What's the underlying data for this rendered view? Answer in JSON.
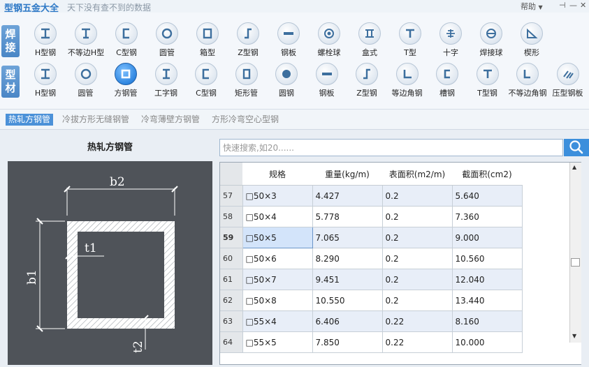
{
  "app": {
    "title": "型钢五金大全",
    "subtitle": "天下没有查不到的数据",
    "help": "帮助",
    "help_arrow": "▼"
  },
  "window_controls": {
    "pin": "⊣",
    "minimize": "—",
    "close": "✕"
  },
  "ribbon": {
    "group1": {
      "label": "焊接",
      "items": [
        {
          "label": "H型钢",
          "icon": "h-beam-icon"
        },
        {
          "label": "不等边H型",
          "icon": "unequal-h-icon"
        },
        {
          "label": "C型钢",
          "icon": "c-channel-icon"
        },
        {
          "label": "圆管",
          "icon": "round-pipe-icon"
        },
        {
          "label": "箱型",
          "icon": "box-section-icon"
        },
        {
          "label": "Z型钢",
          "icon": "z-section-icon"
        },
        {
          "label": "钢板",
          "icon": "steel-plate-icon"
        },
        {
          "label": "螺栓球",
          "icon": "bolt-ball-icon"
        },
        {
          "label": "盒式",
          "icon": "box-type-icon"
        },
        {
          "label": "T型",
          "icon": "t-section-icon"
        },
        {
          "label": "十字",
          "icon": "cross-section-icon"
        },
        {
          "label": "焊接球",
          "icon": "weld-ball-icon"
        },
        {
          "label": "楔形",
          "icon": "wedge-icon"
        }
      ]
    },
    "group2": {
      "label": "型材",
      "items": [
        {
          "label": "H型钢",
          "icon": "h-beam-icon"
        },
        {
          "label": "圆管",
          "icon": "round-pipe-icon"
        },
        {
          "label": "方钢管",
          "icon": "square-tube-icon"
        },
        {
          "label": "工字钢",
          "icon": "i-beam-icon"
        },
        {
          "label": "C型钢",
          "icon": "c-channel-icon"
        },
        {
          "label": "矩形管",
          "icon": "rect-tube-icon"
        },
        {
          "label": "圆钢",
          "icon": "round-bar-icon"
        },
        {
          "label": "钢板",
          "icon": "steel-plate-icon"
        },
        {
          "label": "Z型钢",
          "icon": "z-section-icon"
        },
        {
          "label": "等边角钢",
          "icon": "equal-angle-icon"
        },
        {
          "label": "槽钢",
          "icon": "channel-icon"
        },
        {
          "label": "T型钢",
          "icon": "t-section-icon"
        },
        {
          "label": "不等边角钢",
          "icon": "unequal-angle-icon"
        },
        {
          "label": "压型钢板",
          "icon": "profiled-sheet-icon"
        }
      ],
      "selected_index": 2
    }
  },
  "subtabs": [
    {
      "label": "热轧方钢管",
      "active": true
    },
    {
      "label": "冷拔方形无缝钢管",
      "active": false
    },
    {
      "label": "冷弯薄壁方钢管",
      "active": false
    },
    {
      "label": "方形冷弯空心型钢",
      "active": false
    }
  ],
  "diagram": {
    "title": "热轧方钢管",
    "labels": {
      "b2": "b2",
      "b1": "b1",
      "t1": "t1",
      "t2": "t2"
    }
  },
  "search": {
    "placeholder": "快速搜索,如20......",
    "value": ""
  },
  "table": {
    "headers": [
      "规格",
      "重量(kg/m)",
      "表面积(m2/m)",
      "截面积(cm2)"
    ],
    "rows": [
      {
        "idx": "57",
        "spec": "□50×3",
        "weight": "4.427",
        "surface": "0.2",
        "area": "5.640"
      },
      {
        "idx": "58",
        "spec": "□50×4",
        "weight": "5.778",
        "surface": "0.2",
        "area": "7.360"
      },
      {
        "idx": "59",
        "spec": "□50×5",
        "weight": "7.065",
        "surface": "0.2",
        "area": "9.000"
      },
      {
        "idx": "60",
        "spec": "□50×6",
        "weight": "8.290",
        "surface": "0.2",
        "area": "10.560"
      },
      {
        "idx": "61",
        "spec": "□50×7",
        "weight": "9.451",
        "surface": "0.2",
        "area": "12.040"
      },
      {
        "idx": "62",
        "spec": "□50×8",
        "weight": "10.550",
        "surface": "0.2",
        "area": "13.440"
      },
      {
        "idx": "63",
        "spec": "□55×4",
        "weight": "6.406",
        "surface": "0.22",
        "area": "8.160"
      },
      {
        "idx": "64",
        "spec": "□55×5",
        "weight": "7.850",
        "surface": "0.22",
        "area": "10.000"
      }
    ],
    "selected_row_index": 2
  },
  "colors": {
    "accent": "#3c8fdc",
    "tab_active": "#4b91d8",
    "diagram_bg": "#4f5359"
  }
}
